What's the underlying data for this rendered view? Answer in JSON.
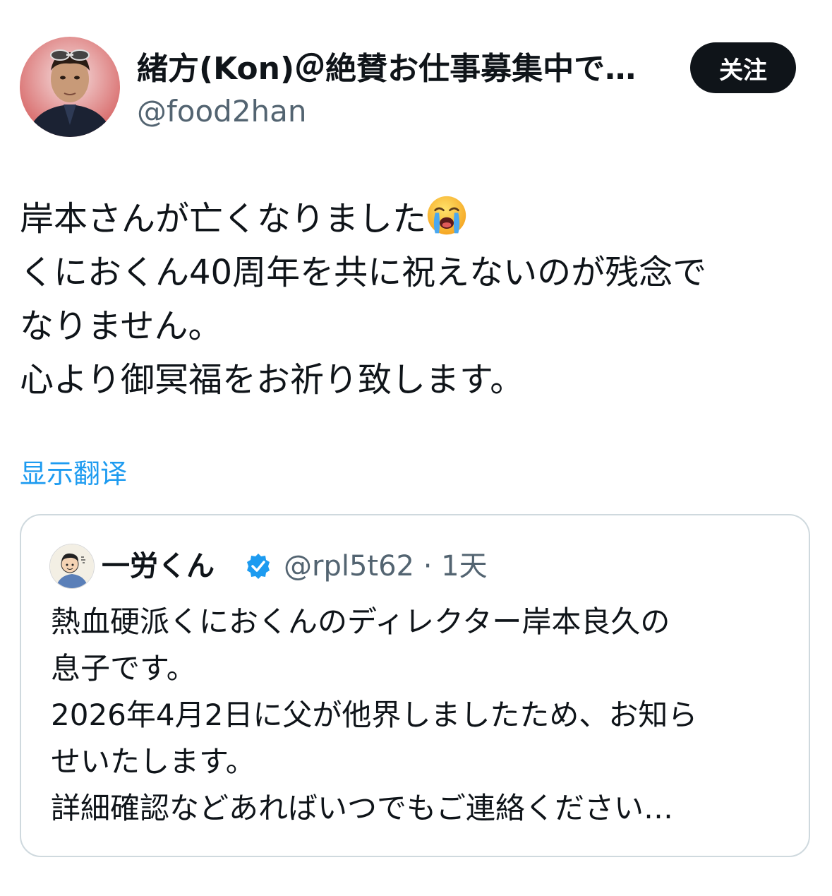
{
  "author": {
    "display_name": "緒方(Kon)＠絶賛お仕事募集中で…",
    "handle": "@food2han"
  },
  "follow_button": {
    "label": "关注"
  },
  "tweet": {
    "lines": [
      "岸本さんが亡くなりました",
      "くにおくん40周年を共に祝えないのが残念で",
      "なりません。",
      "心より御冥福をお祈り致します。"
    ],
    "emoji": "loudly-crying-face"
  },
  "translate": {
    "label": "显示翻译"
  },
  "quoted_tweet": {
    "display_name": "一労くん",
    "handle_time": "@rpl5t62 · 1天",
    "lines": [
      "熱血硬派くにおくんのディレクター岸本良久の",
      "息子です。",
      "2026年4月2日に父が他界しましたため、お知ら",
      "せいたします。",
      "詳細確認などあればいつでもご連絡ください…"
    ]
  },
  "colors": {
    "text": "#0f1419",
    "secondary_text": "#536471",
    "link": "#1d9bf0",
    "button_bg": "#0f1419",
    "border": "#cfd9de",
    "verified": "#1d9bf0"
  }
}
